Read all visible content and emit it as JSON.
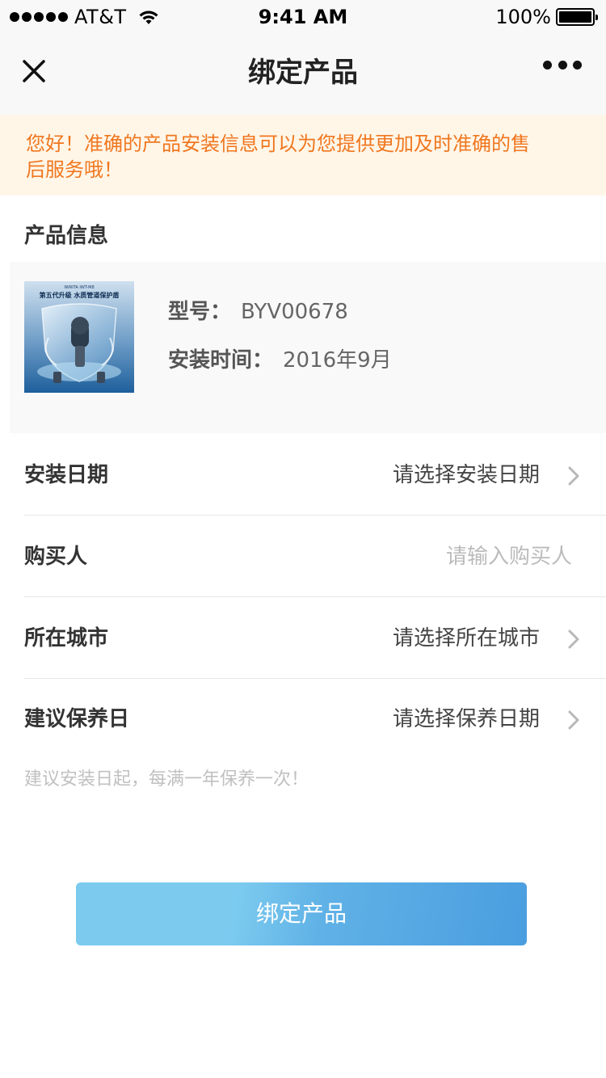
{
  "status_bar": {
    "carrier": "AT&T",
    "time": "9:41 AM",
    "battery": "100%"
  },
  "nav": {
    "title": "绑定产品",
    "close_icon": "close-icon",
    "more_icon": "more-icon"
  },
  "notice": {
    "text": "您好！准确的产品安装信息可以为您提供更加及时准确的售后服务哦！",
    "color": "#f0771f",
    "background": "#fff6e8"
  },
  "product_section": {
    "title": "产品信息",
    "image_caption": "第五代升级 水质管道保护盾",
    "model_label": "型号：",
    "model_value": "BYV00678",
    "install_time_label": "安装时间：",
    "install_time_value": "2016年9月"
  },
  "form": {
    "install_date": {
      "label": "安装日期",
      "value": "请选择安装日期"
    },
    "buyer": {
      "label": "购买人",
      "placeholder": "请输入购买人",
      "value": ""
    },
    "city": {
      "label": "所在城市",
      "value": "请选择所在城市"
    },
    "maintenance": {
      "label": "建议保养日",
      "value": "请选择保养日期"
    },
    "hint": "建议安装日起，每满一年保养一次！"
  },
  "bind_button": {
    "label": "绑定产品",
    "colors": [
      "#7ccbef",
      "#4a9edf"
    ]
  }
}
